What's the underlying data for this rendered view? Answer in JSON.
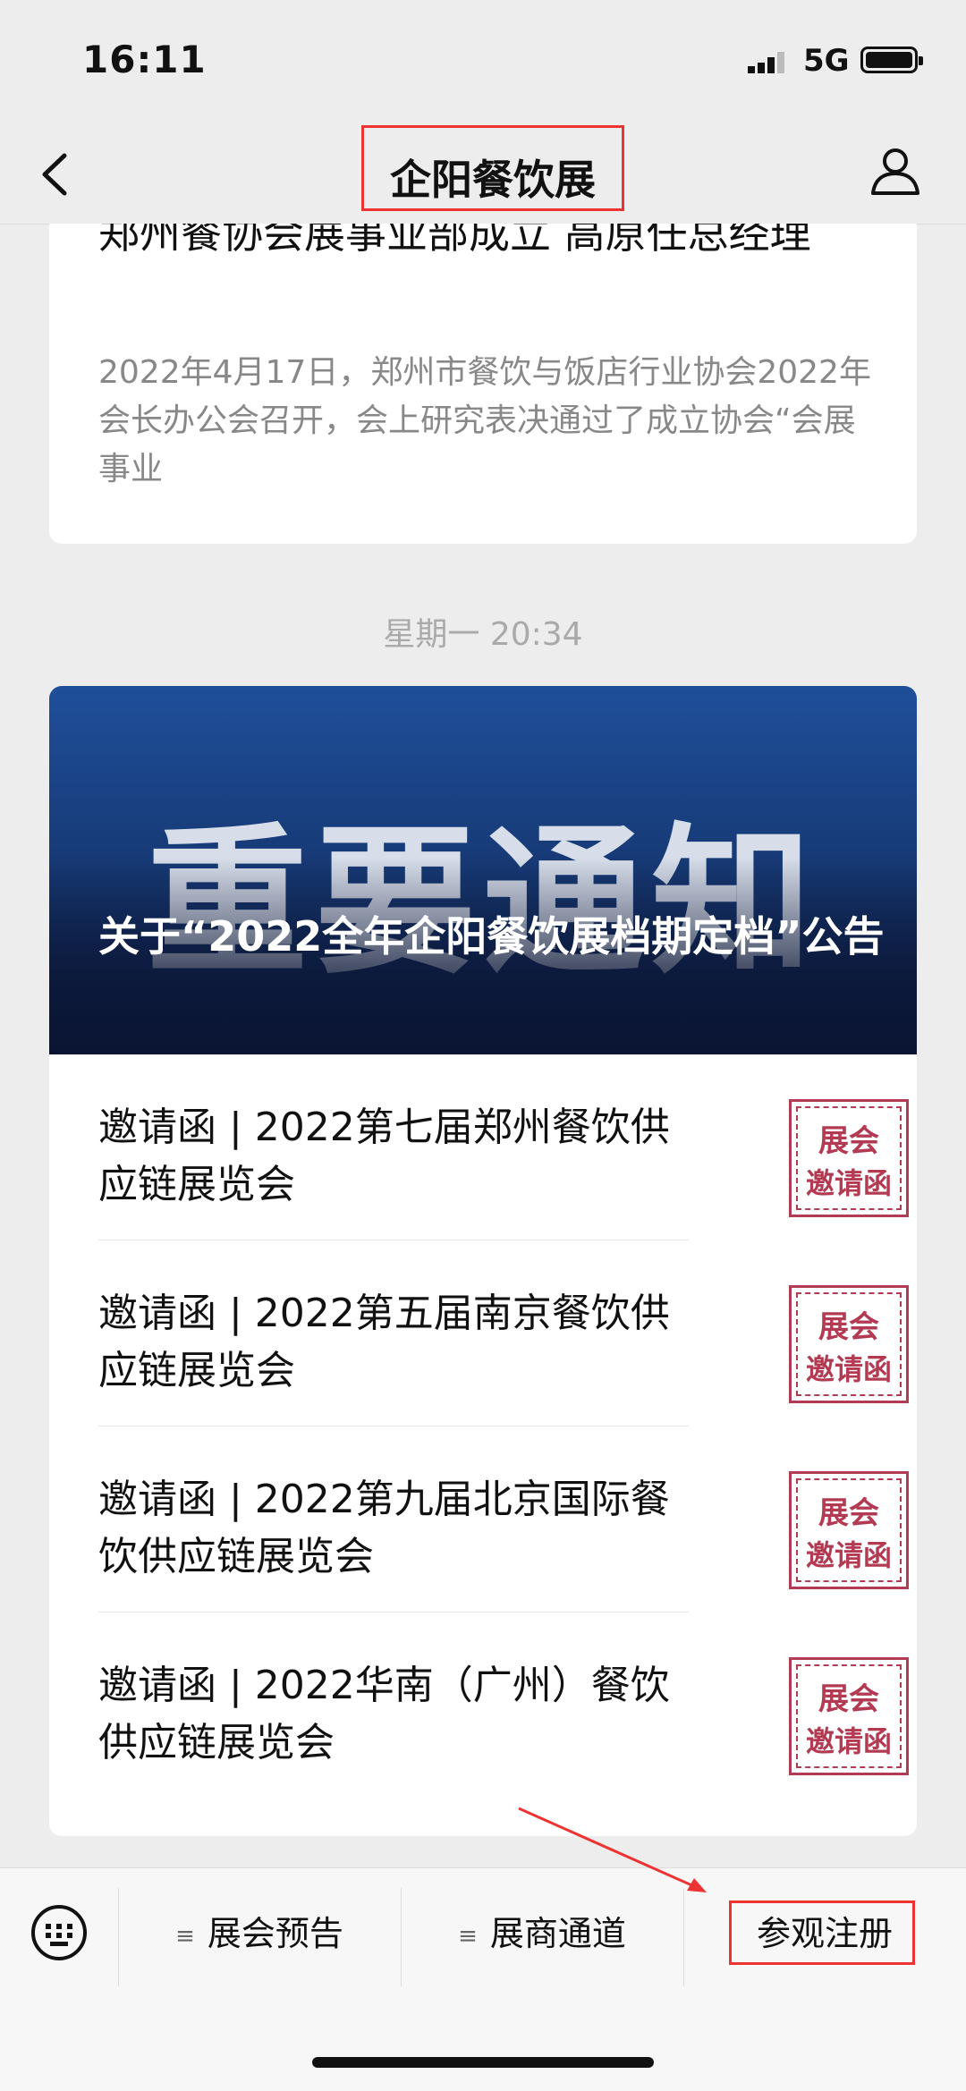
{
  "status_bar": {
    "time": "16:11",
    "network": "5G"
  },
  "nav": {
    "title": "企阳餐饮展",
    "back_icon": "back-arrow-icon",
    "profile_icon": "person-icon"
  },
  "feed": {
    "card1": {
      "title": "郑州餐协会展事业部成立 高原任总经理",
      "desc": "2022年4月17日，郑州市餐饮与饭店行业协会2022年会长办公会召开，会上研究表决通过了成立协会“会展事业"
    },
    "timestamp": "星期一 20:34",
    "card2": {
      "hero_big_text": "重要通知",
      "hero_title": "关于“2022全年企阳餐饮展档期定档”公告",
      "items": [
        {
          "title": "邀请函 | 2022第七届郑州餐饮供应链展览会",
          "badge_line1": "展会",
          "badge_line2": "邀请函"
        },
        {
          "title": "邀请函 | 2022第五届南京餐饮供应链展览会",
          "badge_line1": "展会",
          "badge_line2": "邀请函"
        },
        {
          "title": "邀请函 | 2022第九届北京国际餐饮供应链展览会",
          "badge_line1": "展会",
          "badge_line2": "邀请函"
        },
        {
          "title": "邀请函 | 2022华南（广州）餐饮供应链展览会",
          "badge_line1": "展会",
          "badge_line2": "邀请函"
        }
      ]
    }
  },
  "bottom_menu": {
    "keyboard_icon": "keyboard-icon",
    "items": [
      {
        "label": "展会预告"
      },
      {
        "label": "展商通道"
      },
      {
        "label": "参观注册"
      }
    ]
  },
  "colors": {
    "highlight": "#e33333",
    "badge": "#b23a52",
    "background": "#ededed"
  }
}
